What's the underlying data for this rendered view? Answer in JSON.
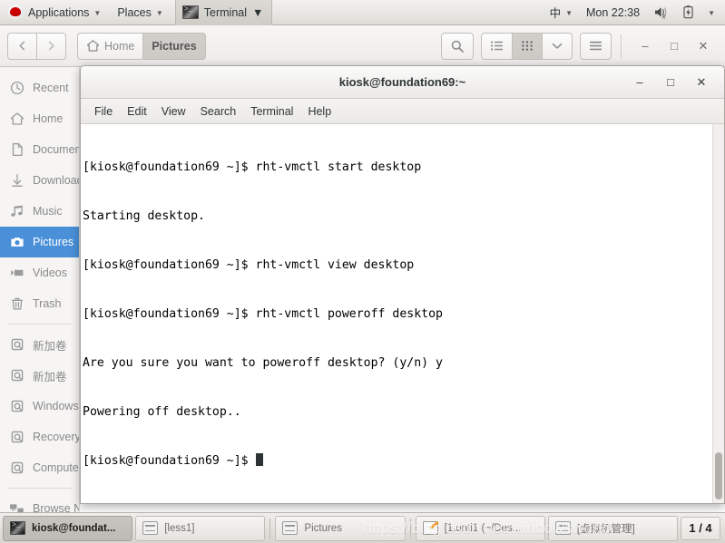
{
  "top_panel": {
    "logo_icon": "redhat-logo-icon",
    "applications_label": "Applications",
    "places_label": "Places",
    "window_indicator_label": "Terminal",
    "caret": "▼",
    "input_method_label": "中",
    "clock": "Mon 22:38",
    "volume_icon": "volume-muted-icon",
    "battery_icon": "battery-icon",
    "system_menu_icon": "chevron-down-icon"
  },
  "file_manager": {
    "back_icon": "chevron-left-icon",
    "forward_icon": "chevron-right-icon",
    "breadcrumbs": [
      {
        "label": "Home",
        "icon": "home-icon",
        "current": false
      },
      {
        "label": "Pictures",
        "icon": "",
        "current": true
      }
    ],
    "search_icon": "search-icon",
    "list_view_icon": "list-view-icon",
    "grid_view_icon": "grid-view-icon",
    "view_options_icon": "chevron-down-icon",
    "menu_icon": "hamburger-menu-icon",
    "minimize_label": "–",
    "maximize_label": "□",
    "close_label": "✕",
    "sidebar": {
      "items": [
        {
          "label": "Recent",
          "icon": "clock-icon",
          "selected": false
        },
        {
          "label": "Home",
          "icon": "home-icon",
          "selected": false
        },
        {
          "label": "Documents",
          "icon": "document-icon",
          "selected": false
        },
        {
          "label": "Downloads",
          "icon": "download-icon",
          "selected": false
        },
        {
          "label": "Music",
          "icon": "music-icon",
          "selected": false
        },
        {
          "label": "Pictures",
          "icon": "camera-icon",
          "selected": true
        },
        {
          "label": "Videos",
          "icon": "video-icon",
          "selected": false
        },
        {
          "label": "Trash",
          "icon": "trash-icon",
          "selected": false
        }
      ],
      "devices": [
        {
          "label": "新加卷",
          "icon": "drive-icon"
        },
        {
          "label": "新加卷",
          "icon": "drive-icon"
        },
        {
          "label": "Windows",
          "icon": "drive-icon"
        },
        {
          "label": "Recovery",
          "icon": "drive-icon"
        },
        {
          "label": "Computer",
          "icon": "drive-icon"
        }
      ],
      "network": [
        {
          "label": "Browse Network",
          "icon": "network-icon"
        }
      ]
    }
  },
  "terminal": {
    "title": "kiosk@foundation69:~",
    "minimize_label": "–",
    "maximize_label": "□",
    "close_label": "✕",
    "menus": [
      "File",
      "Edit",
      "View",
      "Search",
      "Terminal",
      "Help"
    ],
    "lines": [
      "[kiosk@foundation69 ~]$ rht-vmctl start desktop",
      "Starting desktop.",
      "[kiosk@foundation69 ~]$ rht-vmctl view desktop",
      "[kiosk@foundation69 ~]$ rht-vmctl poweroff desktop",
      "Are you sure you want to poweroff desktop? (y/n) y",
      "Powering off desktop..",
      "[kiosk@foundation69 ~]$ "
    ]
  },
  "taskbar": {
    "items": [
      {
        "label": "kiosk@foundat...",
        "icon": "terminal-icon",
        "active": true
      },
      {
        "label": "[less1]",
        "icon": "file-manager-icon",
        "active": false
      },
      {
        "label": "Pictures",
        "icon": "file-manager-icon",
        "active": false
      },
      {
        "label": "[1.unti1 (~/Des...",
        "icon": "text-editor-icon",
        "active": false
      },
      {
        "label": "[虚拟机管理]",
        "icon": "file-manager-icon",
        "active": false
      }
    ],
    "workspace": "1 / 4"
  },
  "watermark": "https://blog.csdn.net/windowsworld",
  "colors": {
    "selection_blue": "#4a90d9",
    "panel_bg": "#e8e6e3",
    "terminal_bg": "#ffffff",
    "terminal_fg": "#000000",
    "brand_red": "#cc0000"
  }
}
